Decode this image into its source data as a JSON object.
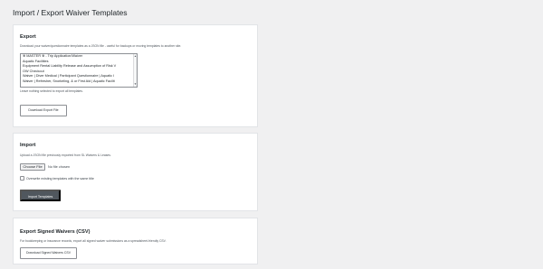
{
  "page": {
    "title": "Import / Export Waiver Templates"
  },
  "export": {
    "title": "Export",
    "description": "Download your waiver/questionnaire templates as a JSON file - useful for backups or moving templates to another site.",
    "options": [
      "※ MASTER ※ - Trip Application/Waiver",
      "Aquatic Facilities",
      "Equipment Rental Liability Release and Assumption of Risk V",
      "OW Checkout",
      "Waiver | Diver Medical | Participant Questionnaire | Aquatic I",
      "Waiver | Refresher, Snorkeling, & or First Aid | Aquatic Facilit"
    ],
    "hint": "Leave nothing selected to export all templates.",
    "download_label": "Download Export File"
  },
  "import": {
    "title": "Import",
    "description": "Upload a JSON file previously exported from SL Waivers & Leases.",
    "choose_file_label": "Choose File",
    "file_status": "No file chosen",
    "overwrite_label": "Overwrite existing templates with the same title",
    "import_label": "Import Templates"
  },
  "csv": {
    "title": "Export Signed Waivers (CSV)",
    "description": "For bookkeeping or insurance records, export all signed waiver submissions as a spreadsheet-friendly CSV.",
    "download_label": "Download Signed Waivers CSV"
  }
}
